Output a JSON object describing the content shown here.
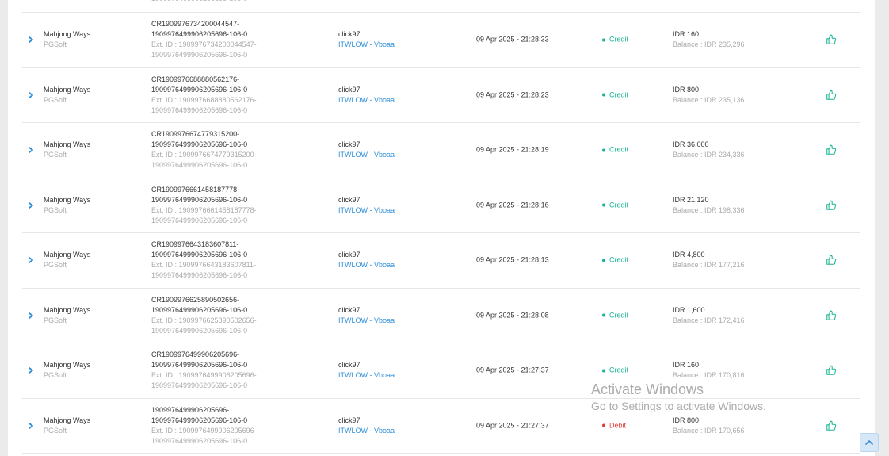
{
  "previous_row": {
    "external_id_tail": "1909976499906205696-106-0"
  },
  "transactions": [
    {
      "game": "Mahjong Ways",
      "provider": "PGSoft",
      "id_line1": "CR1909976734200044547-",
      "id_line2": "1909976499906205696-106-0",
      "ext_line1": "Ext. ID : 1909976734200044547-",
      "ext_line2": "1909976499906205696-106-0",
      "user": "click97",
      "agent": "ITWLOW - Vboaa",
      "datetime": "09 Apr 2025 - 21:28:33",
      "type": "Credit",
      "status": "credit",
      "amount": "IDR 160",
      "balance": "Balance : IDR 235,296"
    },
    {
      "game": "Mahjong Ways",
      "provider": "PGSoft",
      "id_line1": "CR1909976688880562176-",
      "id_line2": "1909976499906205696-106-0",
      "ext_line1": "Ext. ID : 1909976688880562176-",
      "ext_line2": "1909976499906205696-106-0",
      "user": "click97",
      "agent": "ITWLOW - Vboaa",
      "datetime": "09 Apr 2025 - 21:28:23",
      "type": "Credit",
      "status": "credit",
      "amount": "IDR 800",
      "balance": "Balance : IDR 235,136"
    },
    {
      "game": "Mahjong Ways",
      "provider": "PGSoft",
      "id_line1": "CR1909976674779315200-",
      "id_line2": "1909976499906205696-106-0",
      "ext_line1": "Ext. ID : 1909976674779315200-",
      "ext_line2": "1909976499906205696-106-0",
      "user": "click97",
      "agent": "ITWLOW - Vboaa",
      "datetime": "09 Apr 2025 - 21:28:19",
      "type": "Credit",
      "status": "credit",
      "amount": "IDR 36,000",
      "balance": "Balance : IDR 234,336"
    },
    {
      "game": "Mahjong Ways",
      "provider": "PGSoft",
      "id_line1": "CR1909976661458187778-",
      "id_line2": "1909976499906205696-106-0",
      "ext_line1": "Ext. ID : 1909976661458187778-",
      "ext_line2": "1909976499906205696-106-0",
      "user": "click97",
      "agent": "ITWLOW - Vboaa",
      "datetime": "09 Apr 2025 - 21:28:16",
      "type": "Credit",
      "status": "credit",
      "amount": "IDR 21,120",
      "balance": "Balance : IDR 198,336"
    },
    {
      "game": "Mahjong Ways",
      "provider": "PGSoft",
      "id_line1": "CR1909976643183607811-",
      "id_line2": "1909976499906205696-106-0",
      "ext_line1": "Ext. ID : 1909976643183607811-",
      "ext_line2": "1909976499906205696-106-0",
      "user": "click97",
      "agent": "ITWLOW - Vboaa",
      "datetime": "09 Apr 2025 - 21:28:13",
      "type": "Credit",
      "status": "credit",
      "amount": "IDR 4,800",
      "balance": "Balance : IDR 177,216"
    },
    {
      "game": "Mahjong Ways",
      "provider": "PGSoft",
      "id_line1": "CR1909976625890502656-",
      "id_line2": "1909976499906205696-106-0",
      "ext_line1": "Ext. ID : 1909976625890502656-",
      "ext_line2": "1909976499906205696-106-0",
      "user": "click97",
      "agent": "ITWLOW - Vboaa",
      "datetime": "09 Apr 2025 - 21:28:08",
      "type": "Credit",
      "status": "credit",
      "amount": "IDR 1,600",
      "balance": "Balance : IDR 172,416"
    },
    {
      "game": "Mahjong Ways",
      "provider": "PGSoft",
      "id_line1": "CR1909976499906205696-",
      "id_line2": "1909976499906205696-106-0",
      "ext_line1": "Ext. ID : 1909976499906205696-",
      "ext_line2": "1909976499906205696-106-0",
      "user": "click97",
      "agent": "ITWLOW - Vboaa",
      "datetime": "09 Apr 2025 - 21:27:37",
      "type": "Credit",
      "status": "credit",
      "amount": "IDR 160",
      "balance": "Balance : IDR 170,816"
    },
    {
      "game": "Mahjong Ways",
      "provider": "PGSoft",
      "id_line1": "1909976499906205696-",
      "id_line2": "1909976499906205696-106-0",
      "ext_line1": "Ext. ID : 1909976499906205696-",
      "ext_line2": "1909976499906205696-106-0",
      "user": "click97",
      "agent": "ITWLOW - Vboaa",
      "datetime": "09 Apr 2025 - 21:27:37",
      "type": "Debit",
      "status": "debit",
      "amount": "IDR 800",
      "balance": "Balance : IDR 170,656"
    }
  ],
  "icons": {
    "expand": "chevron-right-icon",
    "action": "thumbs-up-icon",
    "scroll_top": "chevron-up-icon"
  },
  "colors": {
    "credit": "#1ab394",
    "debit": "#e53935",
    "link": "#2f8fd8",
    "primary_text": "#333333",
    "muted_text": "#aaaaaa"
  },
  "watermark": {
    "title": "Activate Windows",
    "subtitle": "Go to Settings to activate Windows."
  }
}
